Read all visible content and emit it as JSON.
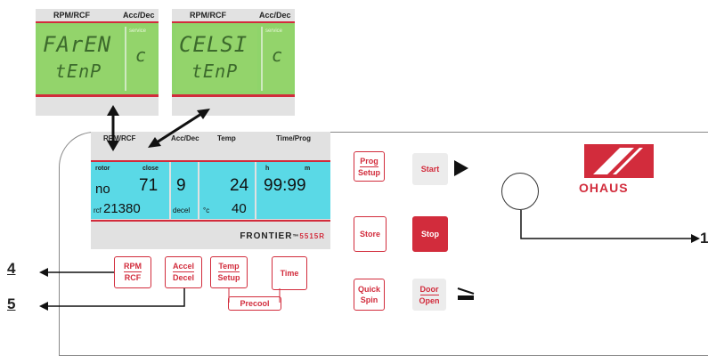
{
  "zoom_left": {
    "header_rpm": "RPM/RCF",
    "header_acc": "Acc/Dec",
    "line1": "FArEN",
    "line2": "tEnP",
    "service": "service",
    "right_char": "c"
  },
  "zoom_right": {
    "header_rpm": "RPM/RCF",
    "header_acc": "Acc/Dec",
    "line1": "CELSI",
    "line2": "tEnP",
    "service": "service",
    "right_char": "c"
  },
  "display": {
    "header": {
      "rpm": "RPM/RCF",
      "acc": "Acc/Dec",
      "temp": "Temp",
      "time": "Time/Prog"
    },
    "rotor_label": "rotor",
    "close_label": "close",
    "rotor_value": "no",
    "speed_value": "71",
    "rcf_label": "rcf",
    "rcf_value": "21380",
    "accel_value": "9",
    "decel_label": "decel",
    "temp_value": "24",
    "temp_unit": "°c",
    "temp_set": "40",
    "h_label": "h",
    "m_label": "m",
    "time_value": "99:99",
    "brand": "FRONTIER",
    "model": "5515R",
    "tm": "™"
  },
  "keys": {
    "prog_line1": "Prog",
    "prog_line2": "Setup",
    "start": "Start",
    "store": "Store",
    "stop": "Stop",
    "quick_line1": "Quick",
    "quick_line2": "Spin",
    "door_line1": "Door",
    "door_line2": "Open",
    "rpm_line1": "RPM",
    "rpm_line2": "RCF",
    "accel_line1": "Accel",
    "accel_line2": "Decel",
    "temp_line1": "Temp",
    "temp_line2": "Setup",
    "time": "Time",
    "precool": "Precool"
  },
  "logo_text": "OHAUS",
  "callouts": {
    "n1": "1",
    "n4": "4",
    "n5": "5"
  },
  "colors": {
    "accent_red": "#d22c3c",
    "lcd_green": "#93d46b",
    "lcd_cyan": "#5ad9e6"
  },
  "icons": [
    "start-arrow-icon",
    "door-open-icon",
    "ohaus-logo-icon",
    "knob-circle-icon"
  ]
}
